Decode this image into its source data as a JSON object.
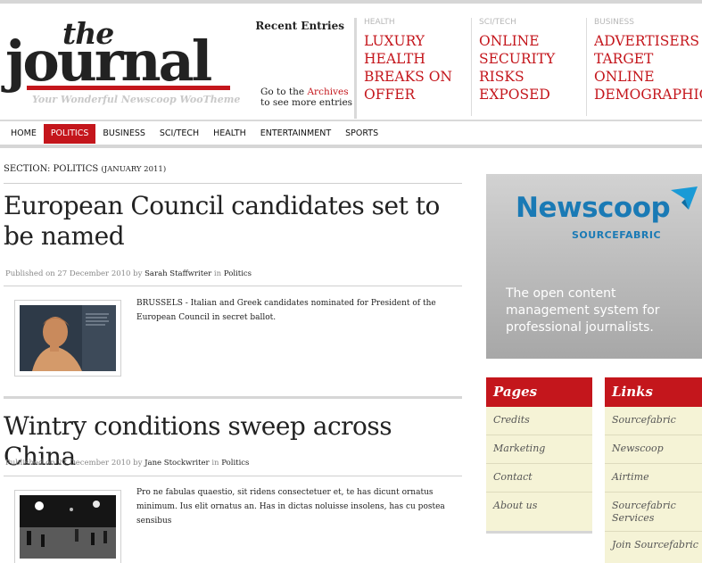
{
  "logo": {
    "the": "the",
    "journal": "journal",
    "tagline": "Your Wonderful Newscoop WooTheme"
  },
  "recent": {
    "title": "Recent Entries",
    "note_prefix": "Go to the ",
    "archives_link": "Archives",
    "note_suffix": "to see more entries"
  },
  "featured": [
    {
      "category": "HEALTH",
      "title_lines": [
        "LUXURY",
        "HEALTH",
        "BREAKS ON",
        "OFFER"
      ]
    },
    {
      "category": "SCI/TECH",
      "title_lines": [
        "ONLINE",
        "SECURITY",
        "RISKS",
        "EXPOSED"
      ]
    },
    {
      "category": "BUSINESS",
      "title_lines": [
        "ADVERTISERS",
        "TARGET",
        "ONLINE",
        "DEMOGRAPHIC"
      ]
    }
  ],
  "nav": [
    "HOME",
    "POLITICS",
    "BUSINESS",
    "SCI/TECH",
    "HEALTH",
    "ENTERTAINMENT",
    "SPORTS"
  ],
  "nav_active": "POLITICS",
  "section": {
    "label": "SECTION: POLITICS",
    "date": "(JANUARY 2011)"
  },
  "articles": [
    {
      "title": "European Council candidates set to be named",
      "published_prefix": "Published on 27 December 2010 by ",
      "author": "Sarah Staffwriter",
      "in_text": " in ",
      "category": "Politics",
      "excerpt": "BRUSSELS - Italian and Greek candidates nominated for President of the European Council in secret ballot."
    },
    {
      "title": "Wintry conditions sweep across China",
      "published_prefix": "Published on 27 December 2010 by ",
      "author": "Jane Stockwriter",
      "in_text": " in ",
      "category": "Politics",
      "excerpt": "Pro ne fabulas quaestio, sit ridens consectetuer et, te has dicunt ornatus minimum. Ius elit ornatus an. Has in dictas noluisse insolens, has cu postea sensibus"
    }
  ],
  "ad": {
    "brand": "Newscoop",
    "sub": "SOURCEFABRIC",
    "text": "The open content management system for professional journalists.",
    "colors": {
      "brand": "#1a7ab5"
    }
  },
  "pages_widget": {
    "title": "Pages",
    "items": [
      "Credits",
      "Marketing",
      "Contact",
      "About us"
    ]
  },
  "links_widget": {
    "title": "Links",
    "items": [
      [
        "Sourcefabric"
      ],
      [
        "Newscoop"
      ],
      [
        "Airtime"
      ],
      [
        "Sourcefabric",
        "Services"
      ],
      [
        "Join Sourcefabric"
      ]
    ]
  },
  "colors": {
    "accent": "#c4161c",
    "widget_bg": "#f5f3d6"
  }
}
